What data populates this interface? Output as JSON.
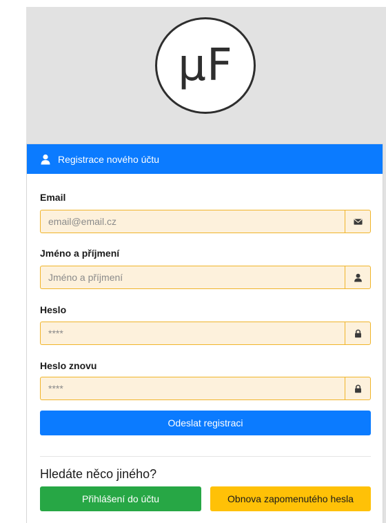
{
  "logo": {
    "text": "µF"
  },
  "card": {
    "header_title": "Registrace nového účtu",
    "header_icon": "user-icon"
  },
  "fields": {
    "email": {
      "label": "Email",
      "placeholder": "email@email.cz",
      "value": "",
      "icon": "envelope-icon"
    },
    "name": {
      "label": "Jméno a příjmení",
      "placeholder": "Jméno a příjmení",
      "value": "",
      "icon": "user-icon"
    },
    "password": {
      "label": "Heslo",
      "placeholder": "****",
      "value": "",
      "icon": "lock-icon"
    },
    "password_again": {
      "label": "Heslo znovu",
      "placeholder": "****",
      "value": "",
      "icon": "lock-icon"
    }
  },
  "submit_label": "Odeslat registraci",
  "other": {
    "heading": "Hledáte něco jiného?",
    "login_label": "Přihlášení do účtu",
    "reset_label": "Obnova zapomenutého hesla"
  },
  "colors": {
    "primary": "#0b7bff",
    "success": "#27a745",
    "warning": "#ffc107",
    "input_bg": "#fdf1dc",
    "input_border": "#f0b429",
    "background": "#e2e2e2"
  }
}
